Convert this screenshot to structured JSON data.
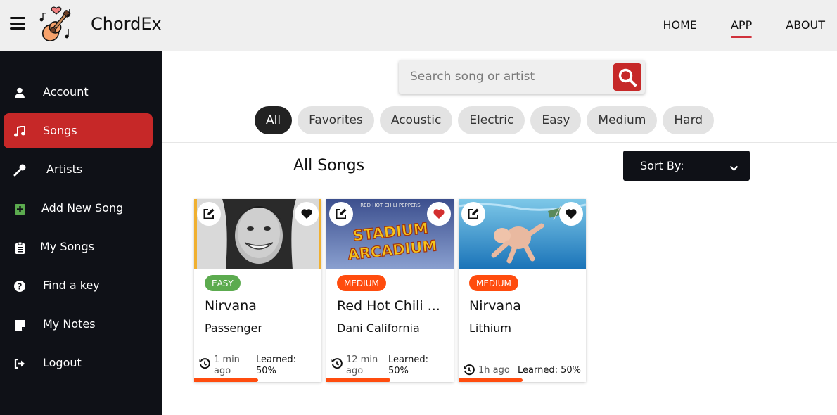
{
  "header": {
    "title": "ChordEx",
    "nav": [
      {
        "label": "HOME",
        "active": false
      },
      {
        "label": "APP",
        "active": true
      },
      {
        "label": "ABOUT",
        "active": false
      }
    ]
  },
  "sidebar": {
    "items": [
      {
        "label": "Account",
        "icon": "user-icon",
        "active": false
      },
      {
        "label": "Songs",
        "icon": "music-note-icon",
        "active": true
      },
      {
        "label": "Artists",
        "icon": "microphone-icon",
        "active": false
      },
      {
        "label": "Add New Song",
        "icon": "plus-square-icon",
        "active": false
      },
      {
        "label": "My Songs",
        "icon": "clipboard-list-icon",
        "active": false
      },
      {
        "label": "Find a key",
        "icon": "question-circle-icon",
        "active": false
      },
      {
        "label": "My Notes",
        "icon": "sticky-note-icon",
        "active": false
      },
      {
        "label": "Logout",
        "icon": "sign-out-icon",
        "active": false
      }
    ]
  },
  "search": {
    "placeholder": "Search song or artist",
    "value": ""
  },
  "filters": {
    "chips": [
      "All",
      "Favorites",
      "Acoustic",
      "Electric",
      "Easy",
      "Medium",
      "Hard"
    ],
    "active": "All"
  },
  "main": {
    "section_title": "All Songs",
    "sort_label": "Sort By:"
  },
  "cards": [
    {
      "difficulty": "EASY",
      "artist": "Nirvana",
      "song": "Passenger",
      "time": "1 min ago",
      "learned": "Learned: 50%",
      "progress": 0.5,
      "favorite": false
    },
    {
      "difficulty": "MEDIUM",
      "artist": "Red Hot Chili ...",
      "song": "Dani California",
      "time": "12 min ago",
      "learned": "Learned: 50%",
      "progress": 0.5,
      "favorite": true,
      "cover_text_top": "RED HOT CHILI PEPPERS",
      "cover_text_1": "STADIUM",
      "cover_text_2": "ARCADIUM"
    },
    {
      "difficulty": "MEDIUM",
      "artist": "Nirvana",
      "song": "Lithium",
      "time": "1h ago",
      "learned": "Learned: 50%",
      "progress": 0.5,
      "favorite": false
    }
  ],
  "colors": {
    "accent": "#c62828",
    "sidebar_bg": "#0f1117",
    "easy": "#5cab4f",
    "medium": "#ff4c0e",
    "favorite_heart": "#d32f2f"
  }
}
